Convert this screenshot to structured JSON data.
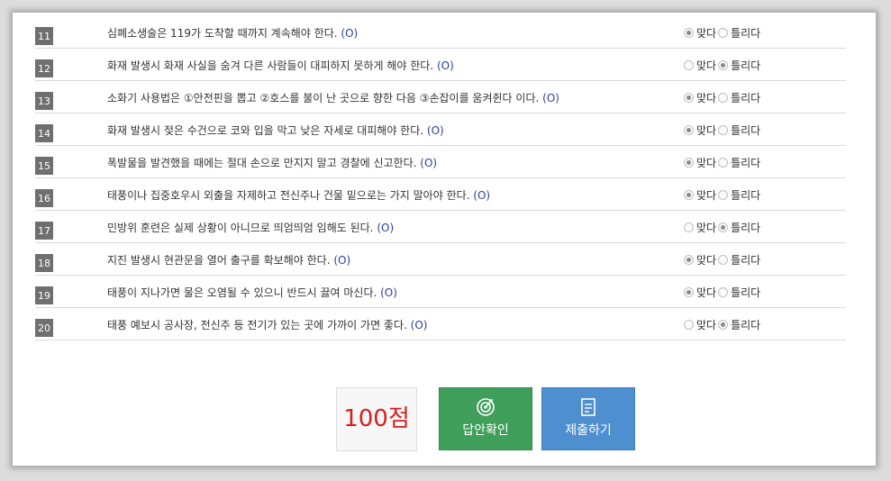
{
  "questions": [
    {
      "num": "11",
      "text": "심폐소생술은 119가 도착할 때까지 계속해야 한다.",
      "answer": "(O)",
      "selected": "right"
    },
    {
      "num": "12",
      "text": "화재 발생시 화재 사실을 숨겨 다른 사람들이 대피하지 못하게 해야 한다.",
      "answer": "(O)",
      "selected": "wrong"
    },
    {
      "num": "13",
      "text": "소화기 사용법은 ①안전핀을 뽑고 ②호스를 불이 난 곳으로 향한 다음 ③손잡이를 움켜쥔다 이다.",
      "answer": "(O)",
      "selected": "right"
    },
    {
      "num": "14",
      "text": "화재 발생시 젖은 수건으로 코와 입을 막고 낮은 자세로 대피해야 한다.",
      "answer": "(O)",
      "selected": "right"
    },
    {
      "num": "15",
      "text": "폭발물을 발견했을 때에는 절대 손으로 만지지 말고 경찰에 신고한다.",
      "answer": "(O)",
      "selected": "right"
    },
    {
      "num": "16",
      "text": "태풍이나 집중호우시 외출을 자제하고 전신주나 건물 밑으로는 가지 말아야 한다.",
      "answer": "(O)",
      "selected": "right"
    },
    {
      "num": "17",
      "text": "민방위 훈련은 실제 상황이 아니므로 띄엄띄엄 임해도 된다.",
      "answer": "(O)",
      "selected": "wrong"
    },
    {
      "num": "18",
      "text": "지진 발생시 현관문을 열어 출구를 확보해야 한다.",
      "answer": "(O)",
      "selected": "right"
    },
    {
      "num": "19",
      "text": "태풍이 지나가면 물은 오염될 수 있으니 반드시 끓여 마신다.",
      "answer": "(O)",
      "selected": "right"
    },
    {
      "num": "20",
      "text": "태풍 예보시 공사장, 전신주 등 전기가 있는 곳에 가까이 가면 좋다.",
      "answer": "(O)",
      "selected": "wrong"
    }
  ],
  "options": {
    "right": "맞다",
    "wrong": "틀리다"
  },
  "score": "100점",
  "buttons": {
    "check": "답안확인",
    "submit": "제출하기"
  },
  "icons": {
    "check": "target-icon",
    "submit": "document-icon"
  },
  "colors": {
    "check_button": "#3f9f5b",
    "submit_button": "#4d8fcf",
    "score_text": "#d81f1f",
    "answer_text": "#2b3fa0"
  }
}
